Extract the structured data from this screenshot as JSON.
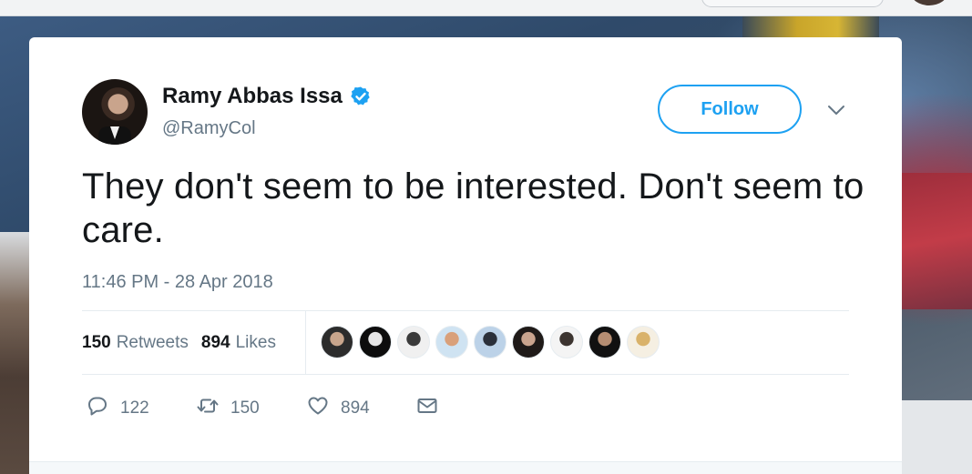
{
  "tweet": {
    "author": {
      "display_name": "Ramy Abbas Issa",
      "handle": "@RamyCol",
      "verified": true
    },
    "follow_label": "Follow",
    "text": "They don't seem to be interested. Don't seem to care.",
    "timestamp": "11:46 PM - 28 Apr 2018",
    "stats": {
      "retweets_count": "150",
      "retweets_label": "Retweets",
      "likes_count": "894",
      "likes_label": "Likes"
    },
    "actions": {
      "reply_count": "122",
      "retweet_count": "150",
      "like_count": "894"
    },
    "liker_avatars": [
      {
        "color_a": "#2c2c2c",
        "color_b": "#c8a58c"
      },
      {
        "color_a": "#0d0d0d",
        "color_b": "#e6e6e6"
      },
      {
        "color_a": "#f0f0f0",
        "color_b": "#3a3a3a"
      },
      {
        "color_a": "#cfe3f2",
        "color_b": "#d9a07a"
      },
      {
        "color_a": "#bcd2e8",
        "color_b": "#2a2f3a"
      },
      {
        "color_a": "#1f1a18",
        "color_b": "#caa48e"
      },
      {
        "color_a": "#f4f4f4",
        "color_b": "#3c3430"
      },
      {
        "color_a": "#111111",
        "color_b": "#b58d72"
      },
      {
        "color_a": "#f5efe2",
        "color_b": "#d9b26a"
      }
    ],
    "colors": {
      "accent": "#1da1f2",
      "text_primary": "#14171a",
      "text_secondary": "#657786",
      "divider": "#e6ecf0"
    },
    "icons": [
      "verified-badge-icon",
      "chevron-down-icon",
      "reply-icon",
      "retweet-icon",
      "heart-icon",
      "envelope-icon"
    ]
  }
}
